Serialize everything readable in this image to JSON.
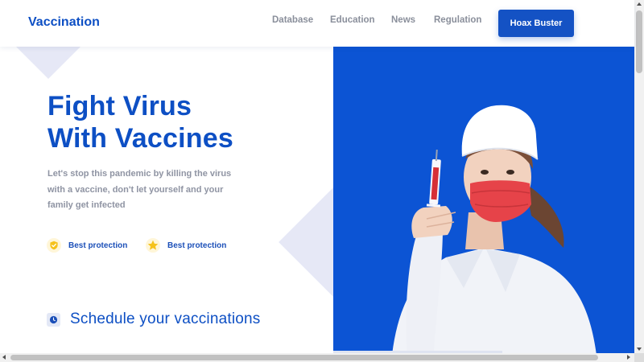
{
  "header": {
    "brand": "Vaccination",
    "nav": [
      "Database",
      "Education",
      "News",
      "Regulation"
    ],
    "cta_label": "Hoax Buster"
  },
  "hero": {
    "title_line1": "Fight Virus",
    "title_line2": "With Vaccines",
    "description": "Let's stop this pandemic by killing the virus with a vaccine, don't let yourself and your family get infected",
    "features": [
      {
        "icon": "shield-check-icon",
        "label": "Best protection"
      },
      {
        "icon": "star-icon",
        "label": "Best protection"
      }
    ]
  },
  "schedule": {
    "icon": "clock-icon",
    "title": "Schedule your vaccinations"
  },
  "colors": {
    "brand_blue": "#0d4fc4",
    "panel_blue": "#0c54d4",
    "accent_yellow": "#f5c21b",
    "decoration": "#e6e8f6"
  }
}
